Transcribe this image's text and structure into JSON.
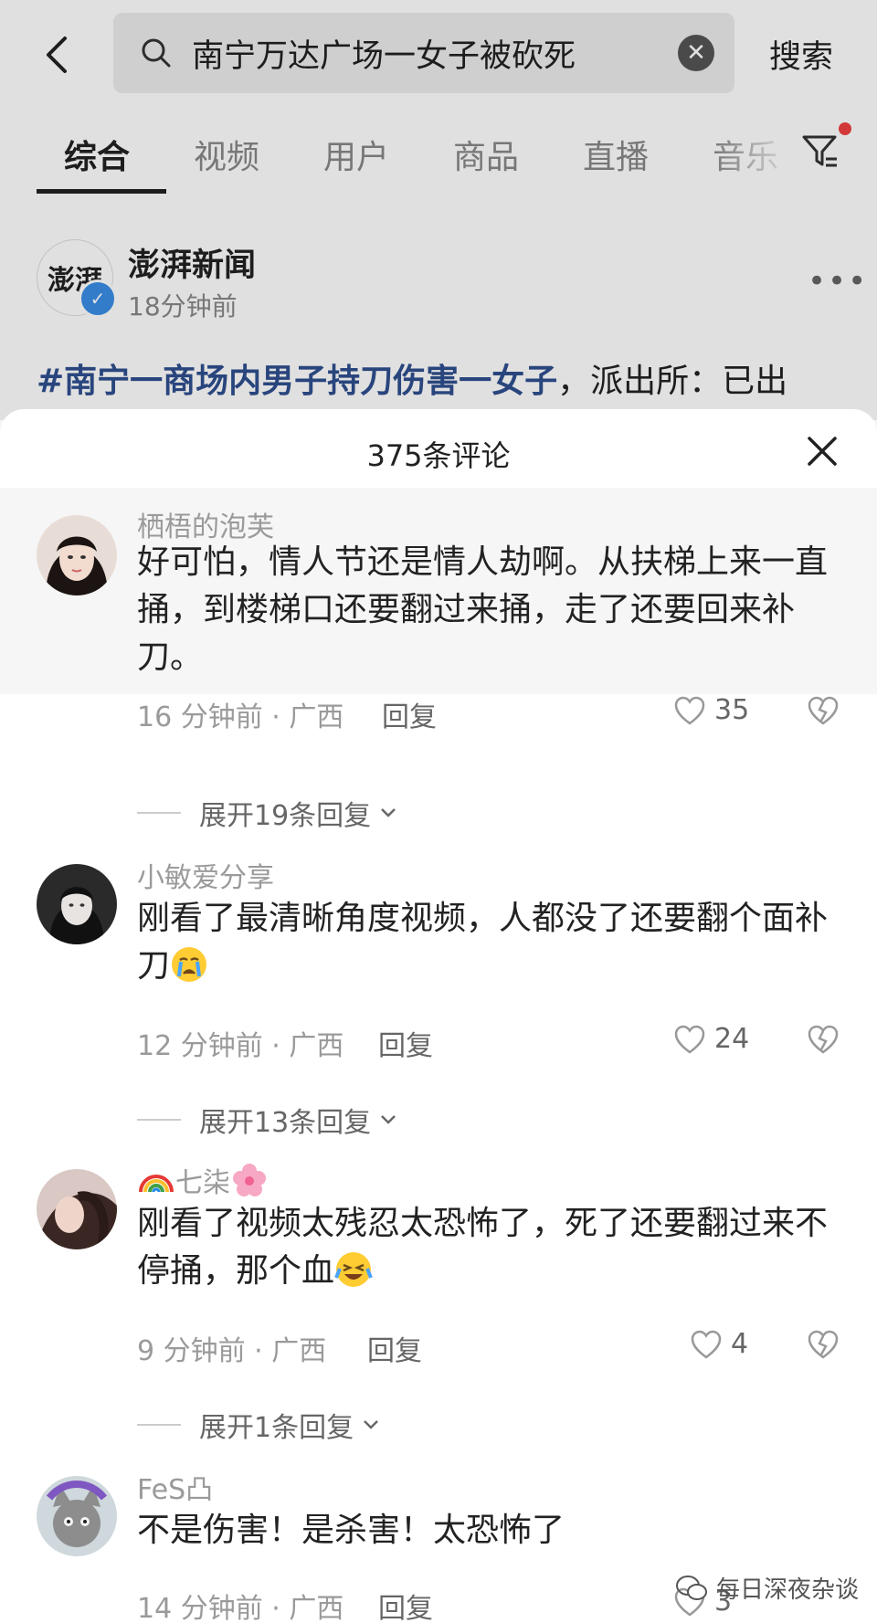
{
  "search": {
    "query": "南宁万达广场一女子被砍死",
    "button_label": "搜索"
  },
  "tabs": [
    {
      "label": "综合",
      "active": true
    },
    {
      "label": "视频"
    },
    {
      "label": "用户"
    },
    {
      "label": "商品"
    },
    {
      "label": "直播"
    },
    {
      "label": "音乐"
    }
  ],
  "post": {
    "author": "澎湃新闻",
    "avatar_text": "澎湃",
    "time": "18分钟前",
    "hashtag": "#南宁一商场内男子持刀伤害一女子",
    "text": "，派出所：已出"
  },
  "sheet": {
    "title": "375条评论"
  },
  "comments": [
    {
      "user": "栖梧的泡芙",
      "text": "好可怕，情人节还是情人劫啊。从扶梯上来一直捅，到楼梯口还要翻过来捅，走了还要回来补刀。",
      "time_location": "16 分钟前 · 广西",
      "reply_label": "回复",
      "likes": "35",
      "expand": "展开19条回复"
    },
    {
      "user": "小敏爱分享",
      "text": "刚看了最清晰角度视频，人都没了还要翻个面补刀",
      "time_location": "12 分钟前 · 广西",
      "reply_label": "回复",
      "likes": "24",
      "expand": "展开13条回复"
    },
    {
      "user": "七柒",
      "text": "刚看了视频太残忍太恐怖了，死了还要翻过来不停捅，那个血",
      "time_location": "9 分钟前 · 广西",
      "reply_label": "回复",
      "likes": "4",
      "expand": "展开1条回复"
    },
    {
      "user": "FeS凸",
      "text": "不是伤害！是杀害！太恐怖了",
      "time_location": "14 分钟前 · 广西",
      "reply_label": "回复",
      "likes": "3"
    }
  ],
  "watermark": "每日深夜杂谈",
  "colors": {
    "hashtag": "#2f4f8f",
    "verified": "#3a8ee6",
    "notification_dot": "#f04040"
  }
}
